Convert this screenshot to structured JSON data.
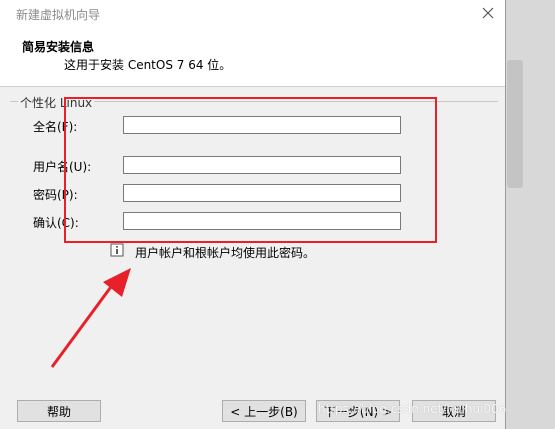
{
  "window": {
    "title": "新建虚拟机向导"
  },
  "header": {
    "title": "简易安装信息",
    "subtitle": "这用于安装 CentOS 7 64 位。"
  },
  "group": {
    "legend": "个性化 Linux"
  },
  "fields": {
    "fullname_label": "全名(F):",
    "fullname_value": "",
    "username_label": "用户名(U):",
    "username_value": "",
    "password_label": "密码(P):",
    "password_value": "",
    "confirm_label": "确认(C):",
    "confirm_value": ""
  },
  "info": {
    "text": "用户帐户和根帐户均使用此密码。"
  },
  "buttons": {
    "help": "帮助",
    "back": "< 上一步(B)",
    "next": "下一步(N) >",
    "cancel": "取消"
  },
  "watermark": "https://blog.csdn.net/huihui006",
  "colors": {
    "annotation": "#e8202a"
  }
}
